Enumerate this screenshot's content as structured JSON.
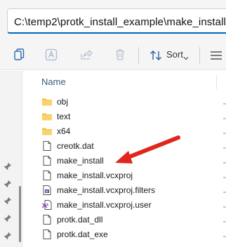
{
  "address": {
    "path": "C:\\temp2\\protk_install_example\\make_install"
  },
  "toolbar": {
    "items": [
      {
        "name": "copy-icon"
      },
      {
        "name": "rename-icon"
      },
      {
        "name": "share-icon"
      },
      {
        "name": "delete-icon"
      }
    ],
    "sort_label": "Sort",
    "more_icon": "view-menu-icon"
  },
  "file_list": {
    "column_header": "Name",
    "items": [
      {
        "label": "obj",
        "type": "folder"
      },
      {
        "label": "text",
        "type": "folder"
      },
      {
        "label": "x64",
        "type": "folder"
      },
      {
        "label": "creotk.dat",
        "type": "file"
      },
      {
        "label": "make_install",
        "type": "file"
      },
      {
        "label": "make_install.vcxproj",
        "type": "file"
      },
      {
        "label": "make_install.vcxproj.filters",
        "type": "filters"
      },
      {
        "label": "make_install.vcxproj.user",
        "type": "vsuser"
      },
      {
        "label": "protk.dat_dll",
        "type": "file"
      },
      {
        "label": "protk.dat_exe",
        "type": "file"
      }
    ]
  },
  "colors": {
    "accent": "#0067c0",
    "folder": "#f3c243",
    "arrow": "#e0261d"
  }
}
